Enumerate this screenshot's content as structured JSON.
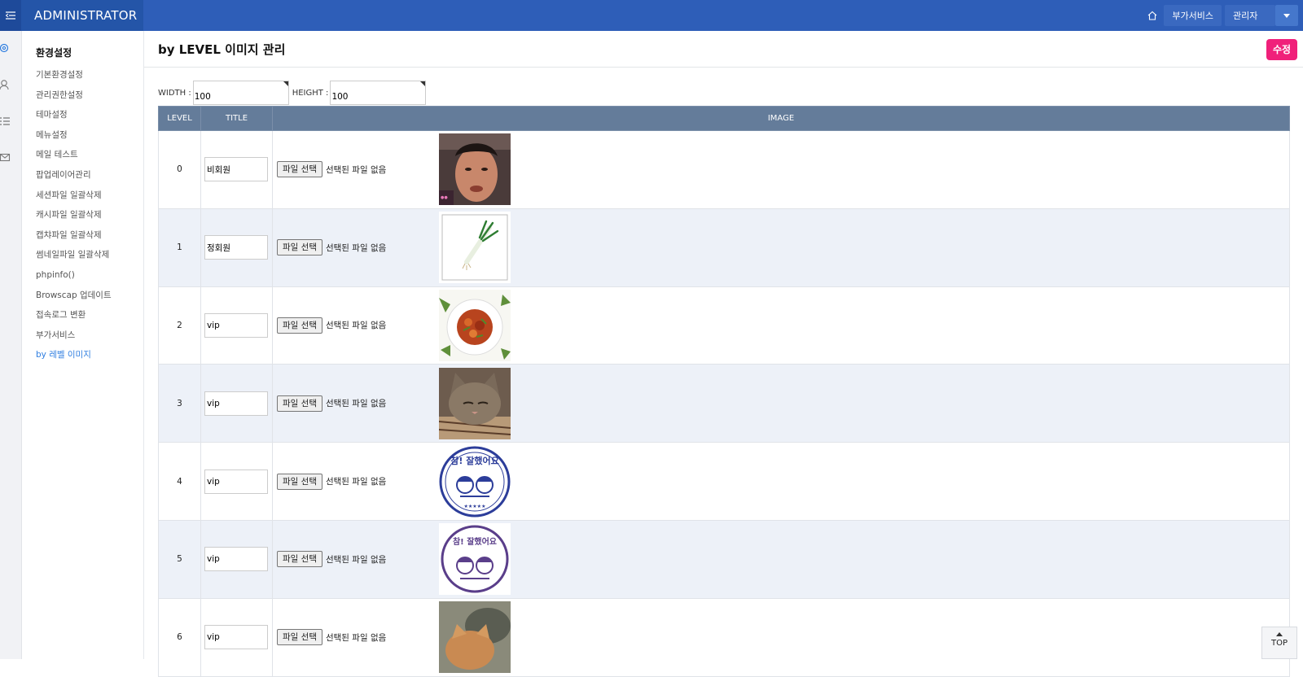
{
  "header": {
    "brand": "ADMINISTRATOR",
    "addon_button": "부가서비스",
    "admin_button": "관리자",
    "primary_color": "#2e5eb8"
  },
  "sidebar": {
    "heading": "환경설정",
    "items": [
      {
        "label": "기본환경설정"
      },
      {
        "label": "관리권한설정"
      },
      {
        "label": "테마설정"
      },
      {
        "label": "메뉴설정"
      },
      {
        "label": "메일 테스트"
      },
      {
        "label": "팝업레이어관리"
      },
      {
        "label": "세션파일 일괄삭제"
      },
      {
        "label": "캐시파일 일괄삭제"
      },
      {
        "label": "캡챠파일 일괄삭제"
      },
      {
        "label": "썸네일파일 일괄삭제"
      },
      {
        "label": "phpinfo()"
      },
      {
        "label": "Browscap 업데이트"
      },
      {
        "label": "접속로그 변환"
      },
      {
        "label": "부가서비스"
      },
      {
        "label": "by 레벨 이미지"
      }
    ],
    "active_index": 14
  },
  "main": {
    "title": "by LEVEL 이미지 관리",
    "edit_button": "수정",
    "width_label": "WIDTH :",
    "width_value": "100",
    "height_label": "HEIGHT :",
    "height_value": "100"
  },
  "table": {
    "headers": {
      "level": "LEVEL",
      "title": "TITLE",
      "image": "IMAGE"
    },
    "file_button": "파일 선택",
    "file_status": "선택된 파일 없음",
    "rows": [
      {
        "level": "0",
        "title": "비회원",
        "image": "photo-man-face"
      },
      {
        "level": "1",
        "title": "정회원",
        "image": "green-onion"
      },
      {
        "level": "2",
        "title": "vip",
        "image": "food-plate"
      },
      {
        "level": "3",
        "title": "vip",
        "image": "cat-photo"
      },
      {
        "level": "4",
        "title": "vip",
        "image": "stamp-참잘했어요"
      },
      {
        "level": "5",
        "title": "vip",
        "image": "stamp-참잘했어요"
      },
      {
        "level": "6",
        "title": "vip",
        "image": "cat-photo-2"
      }
    ]
  },
  "scroll_top": "TOP",
  "stamp_text": [
    "참! 잘했어요",
    "참! 잘했어요"
  ]
}
